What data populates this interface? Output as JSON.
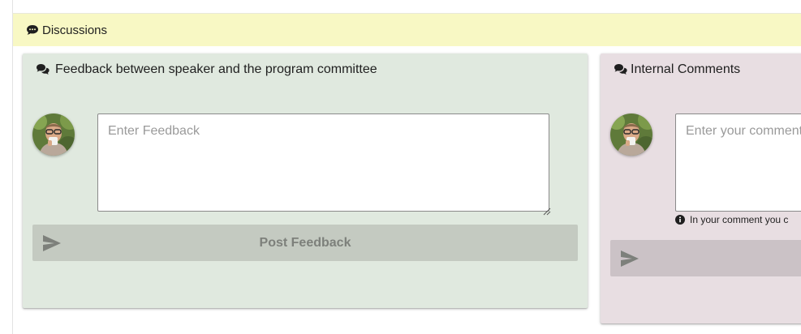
{
  "discussions": {
    "title": "Discussions",
    "icon": "comment-icon",
    "background": "#f8f8c4"
  },
  "feedback": {
    "title": "Feedback between speaker and the program committee",
    "icon": "comments-icon",
    "avatar": "user-avatar",
    "placeholder": "Enter Feedback",
    "button_label": "Post Feedback",
    "button_icon": "send-icon",
    "background": "#e0e9df"
  },
  "internal": {
    "title": "Internal Comments",
    "icon": "comments-icon",
    "avatar": "user-avatar",
    "placeholder": "Enter your comment",
    "hint": "In your comment you c",
    "hint_icon": "info-icon",
    "button_icon": "send-icon",
    "background": "#e8dee2"
  }
}
